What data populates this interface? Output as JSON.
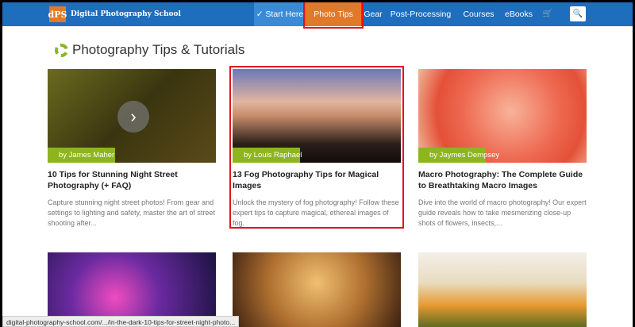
{
  "nav": {
    "logo_mark": "dPS",
    "logo_text": "Digital Photography School",
    "items": [
      "✓ Start Here",
      "Photo Tips",
      "Gear",
      "Post-Processing",
      "Courses",
      "eBooks"
    ],
    "cart_icon": "🛒",
    "search_icon": "🔍"
  },
  "heading": "Photography Tips & Tutorials",
  "cards": [
    {
      "author": "by James Maher",
      "title": "10 Tips for Stunning Night Street Photography (+ FAQ)",
      "desc": "Capture stunning night street photos! From gear and settings to lighting and safety, master the art of street shooting after..."
    },
    {
      "author": "by Louis Raphael",
      "title": "13 Fog Photography Tips for Magical Images",
      "desc": "Unlock the mystery of fog photography! Follow these expert tips to capture magical, ethereal images of fog."
    },
    {
      "author": "by Jaymes Dempsey",
      "title": "Macro Photography: The Complete Guide to Breathtaking Macro Images",
      "desc": "Dive into the world of macro photography! Our expert guide reveals how to take mesmerizing close-up shots of flowers, insects,..."
    }
  ],
  "status_url": "digital-photography-school.com/.../in-the-dark-10-tips-for-street-night-photo..."
}
